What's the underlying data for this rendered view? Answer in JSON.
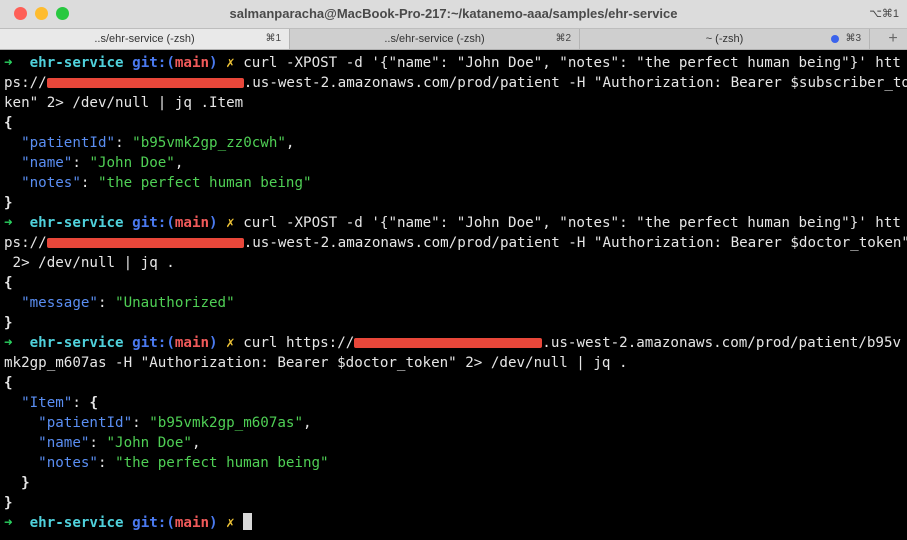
{
  "window": {
    "title": "salmanparacha@MacBook-Pro-217:~/katanemo-aaa/samples/ehr-service",
    "shortcut": "⌥⌘1",
    "lights": [
      "#fe5f57",
      "#febc2e",
      "#28c840"
    ]
  },
  "tabs": [
    {
      "label": "..s/ehr-service (-zsh)",
      "key": "⌘1"
    },
    {
      "label": "..s/ehr-service (-zsh)",
      "key": "⌘2"
    },
    {
      "label": "~ (-zsh)",
      "key": "⌘3"
    }
  ],
  "new_tab": "+",
  "prompt": {
    "arrow": "➜",
    "dir": "ehr-service",
    "git": "git:(",
    "branch": "main",
    "git_close": ")",
    "dirty": "✗"
  },
  "cmd1": {
    "l1": "curl -XPOST -d '{\"name\": \"John Doe\", \"notes\": \"the perfect human being\"}' htt",
    "l2a": "ps://",
    "l2b": ".us-west-2.amazonaws.com/prod/patient -H \"Authorization: Bearer $subscriber_to",
    "l3": "ken\" 2> /dev/null | jq .Item"
  },
  "out1": {
    "open": "{",
    "k1": "\"patientId\"",
    "v1": "\"b95vmk2gp_zz0cwh\"",
    "k2": "\"name\"",
    "v2": "\"John Doe\"",
    "k3": "\"notes\"",
    "v3": "\"the perfect human being\"",
    "close": "}"
  },
  "cmd2": {
    "l1": "curl -XPOST -d '{\"name\": \"John Doe\", \"notes\": \"the perfect human being\"}' htt",
    "l2a": "ps://",
    "l2b": ".us-west-2.amazonaws.com/prod/patient -H \"Authorization: Bearer $doctor_token\"",
    "l3": " 2> /dev/null | jq ."
  },
  "out2": {
    "open": "{",
    "k1": "\"message\"",
    "v1": "\"Unauthorized\"",
    "close": "}"
  },
  "cmd3": {
    "l1a": "curl https://",
    "l1b": ".us-west-2.amazonaws.com/prod/patient/b95v",
    "l2": "mk2gp_m607as -H \"Authorization: Bearer $doctor_token\" 2> /dev/null | jq ."
  },
  "out3": {
    "open": "{",
    "item_key": "\"Item\"",
    "item_open": "{",
    "k1": "\"patientId\"",
    "v1": "\"b95vmk2gp_m607as\"",
    "k2": "\"name\"",
    "v2": "\"John Doe\"",
    "k3": "\"notes\"",
    "v3": "\"the perfect human being\"",
    "item_close": "}",
    "close": "}"
  }
}
